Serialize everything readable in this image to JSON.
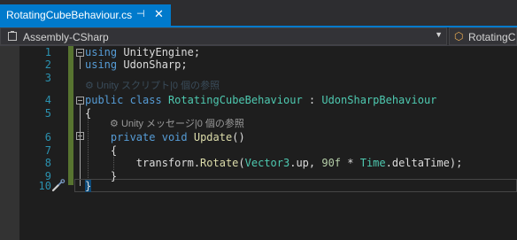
{
  "tab": {
    "filename": "RotatingCubeBehaviour.cs",
    "pin_glyph": "⊣",
    "close_glyph": "✕"
  },
  "navbar": {
    "project": "Assembly-CSharp",
    "dropdown_glyph": "▼",
    "class_name": "RotatingCube"
  },
  "code_lines": [
    {
      "number": "1",
      "parts": [
        {
          "t": "using",
          "c": "kw"
        },
        {
          "t": " UnityEngine;",
          "c": ""
        }
      ]
    },
    {
      "number": "2",
      "parts": [
        {
          "t": "using",
          "c": "kw"
        },
        {
          "t": " UdonSharp;",
          "c": ""
        }
      ]
    },
    {
      "number": "3",
      "parts": []
    },
    {
      "number": "4",
      "parts": [
        {
          "t": "public",
          "c": "kw"
        },
        {
          "t": " ",
          "c": ""
        },
        {
          "t": "class",
          "c": "kw"
        },
        {
          "t": " ",
          "c": ""
        },
        {
          "t": "RotatingCubeBehaviour",
          "c": "ty"
        },
        {
          "t": " : ",
          "c": ""
        },
        {
          "t": "UdonSharpBehaviour",
          "c": "ty"
        }
      ]
    },
    {
      "number": "5",
      "parts": [
        {
          "t": "{",
          "c": ""
        }
      ]
    },
    {
      "number": "6",
      "parts": [
        {
          "t": "    private",
          "c": "kw"
        },
        {
          "t": " ",
          "c": ""
        },
        {
          "t": "void",
          "c": "kw"
        },
        {
          "t": " ",
          "c": ""
        },
        {
          "t": "Update",
          "c": "mt"
        },
        {
          "t": "()",
          "c": ""
        }
      ]
    },
    {
      "number": "7",
      "parts": [
        {
          "t": "    {",
          "c": ""
        }
      ]
    },
    {
      "number": "8",
      "parts": [
        {
          "t": "        transform.",
          "c": ""
        },
        {
          "t": "Rotate",
          "c": "mt"
        },
        {
          "t": "(",
          "c": ""
        },
        {
          "t": "Vector3",
          "c": "ty"
        },
        {
          "t": ".up, ",
          "c": ""
        },
        {
          "t": "90f",
          "c": "num"
        },
        {
          "t": " * ",
          "c": ""
        },
        {
          "t": "Time",
          "c": "ty"
        },
        {
          "t": ".deltaTime);",
          "c": ""
        }
      ]
    },
    {
      "number": "9",
      "parts": [
        {
          "t": "    }",
          "c": ""
        }
      ]
    },
    {
      "number": "10",
      "parts": [
        {
          "t": "}",
          "c": "brace"
        }
      ]
    }
  ],
  "codelens": {
    "class_refs": "Unity スクリプト|0 個の参照",
    "method_refs": "Unity メッセージ|0 個の参照",
    "unity_icon": "⚙"
  },
  "colors": {
    "keyword": "#569cd6",
    "type": "#4ec9b0",
    "method": "#dcdcaa",
    "number": "#b5cea8",
    "line_number": "#2b91af",
    "accent": "#007acc",
    "change_bar": "#577430"
  },
  "icons": {
    "project": "project-icon",
    "class": "class-icon",
    "quick_action": "screwdriver-icon"
  }
}
